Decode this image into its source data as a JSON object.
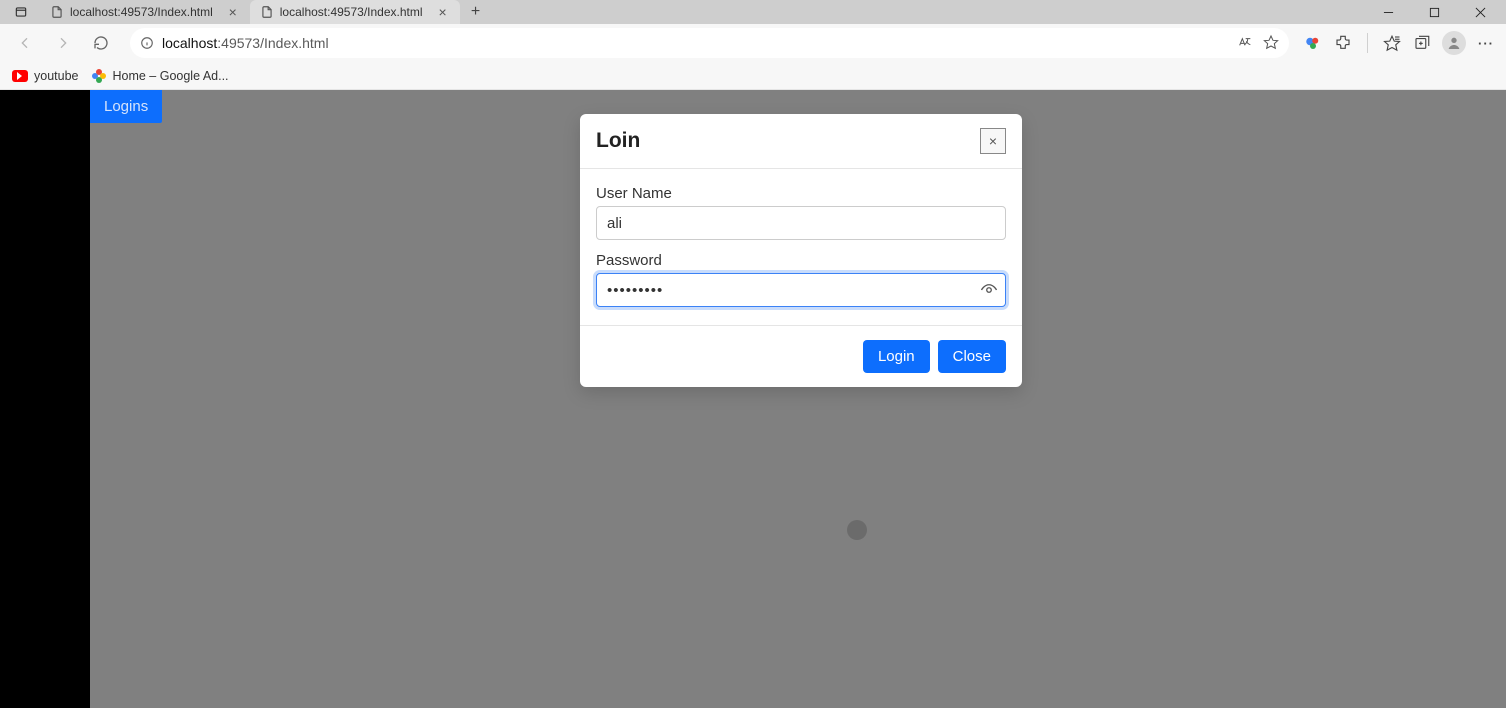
{
  "browser": {
    "tabs": [
      {
        "label": "localhost:49573/Index.html",
        "active": false
      },
      {
        "label": "localhost:49573/Index.html",
        "active": true
      }
    ],
    "url_host": "localhost",
    "url_path": ":49573/Index.html",
    "bookmarks": [
      {
        "label": "youtube"
      },
      {
        "label": "Home – Google Ad..."
      }
    ]
  },
  "page": {
    "logins_button": "Logins"
  },
  "modal": {
    "title": "Loin",
    "close_label": "×",
    "username_label": "User Name",
    "username_value": "ali",
    "password_label": "Password",
    "password_value": "•••••••••",
    "login_button": "Login",
    "close_button": "Close"
  }
}
